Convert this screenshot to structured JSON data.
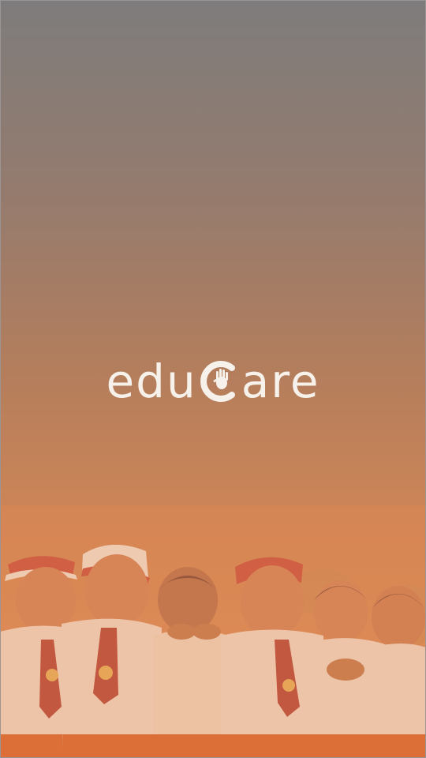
{
  "app": {
    "brand_prefix": "edu",
    "brand_suffix": "are",
    "brand_icon": "hand-in-c-icon"
  },
  "colors": {
    "gradient_top": "#7e7c7c",
    "gradient_bottom": "#e28f5c",
    "logo_text": "#f6f1ea"
  }
}
